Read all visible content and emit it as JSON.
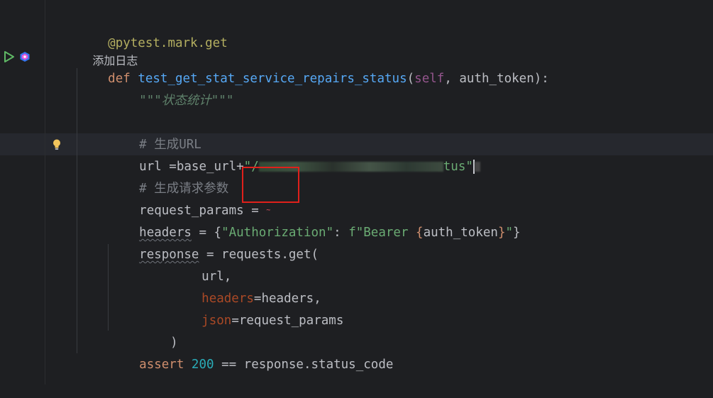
{
  "editor": {
    "gutter": {
      "run_icon": "run-triangle-icon",
      "test_icon": "pytest-icon",
      "bulb_icon": "lightbulb-icon"
    },
    "lines": {
      "l1": {
        "decorator": "@pytest.mark.get"
      },
      "l2": {
        "note": "添加日志"
      },
      "l3": {
        "kw": "def",
        "fn": "test_get_stat_service_repairs_status",
        "open": "(",
        "self": "self",
        "rest": ", auth_token):"
      },
      "l4": {
        "doc": "\"\"\"状态统计\"\"\""
      },
      "l6": {
        "comment": "# 生成URL"
      },
      "l7": {
        "var": "url",
        "rest": " =base_url+",
        "str_start": "\"/",
        "str_end": "tus\""
      },
      "l8": {
        "comment": "# 生成请求参数"
      },
      "l9": {
        "var": "request_params",
        "rest": " = "
      },
      "l10": {
        "var": "headers",
        "eq": " = ",
        "brace_open": "{",
        "key": "\"Authorization\"",
        "colon": ": ",
        "fstr_start": "f\"Bearer ",
        "interp_open": "{",
        "interp_var": "auth_token",
        "interp_close": "}",
        "fstr_end": "\"",
        "brace_close": "}"
      },
      "l11": {
        "var": "response",
        "rest": " = requests.get("
      },
      "l12": {
        "text": "url,"
      },
      "l13": {
        "param": "headers",
        "rest": "=headers,"
      },
      "l14": {
        "param": "json",
        "rest": "=request_params"
      },
      "l15": {
        "text": ")"
      },
      "l16": {
        "kw": "assert",
        "num": "200",
        "rest": " == response.status_code"
      }
    }
  },
  "colors": {
    "background": "#1e1f22",
    "keyword": "#cf8e6d",
    "function": "#56a8f5",
    "string": "#6aab73",
    "comment": "#7a7e85",
    "number": "#2aacb8",
    "decorator": "#b3ae60",
    "highlight_box": "#e0201b"
  }
}
